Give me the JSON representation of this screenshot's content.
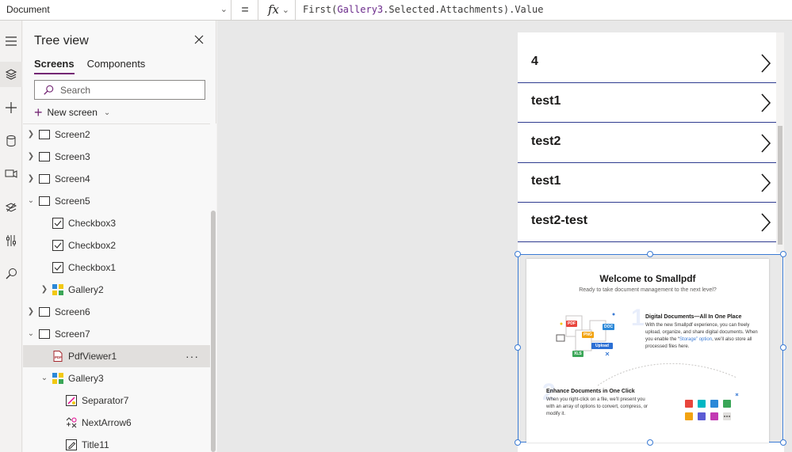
{
  "formula_bar": {
    "property": "Document",
    "equals": "=",
    "fx": "fx",
    "formula_func": "First(",
    "formula_arg": "Gallery3",
    "formula_rest": ".Selected.Attachments).Value"
  },
  "rail": {
    "icons": [
      "menu-icon",
      "layers-icon",
      "plus-icon",
      "database-icon",
      "media-icon",
      "components-icon",
      "tools-icon",
      "search-icon"
    ]
  },
  "tree": {
    "title": "Tree view",
    "tabs": [
      "Screens",
      "Components"
    ],
    "search_placeholder": "Search",
    "new_screen": "New screen",
    "items": [
      {
        "label": "Screen2"
      },
      {
        "label": "Screen3"
      },
      {
        "label": "Screen4"
      },
      {
        "label": "Screen5"
      },
      {
        "label": "Checkbox3"
      },
      {
        "label": "Checkbox2"
      },
      {
        "label": "Checkbox1"
      },
      {
        "label": "Gallery2"
      },
      {
        "label": "Screen6"
      },
      {
        "label": "Screen7"
      },
      {
        "label": "PdfViewer1"
      },
      {
        "label": "Gallery3"
      },
      {
        "label": "Separator7"
      },
      {
        "label": "NextArrow6"
      },
      {
        "label": "Title11"
      }
    ],
    "more": "···"
  },
  "gallery": {
    "rows": [
      "4",
      "test1",
      "test2",
      "test1",
      "test2-test"
    ]
  },
  "pdf": {
    "title": "Welcome to Smallpdf",
    "subtitle": "Ready to take document management to the next level?",
    "section1_title": "Digital Documents—All In One Place",
    "section1_text_a": "With the new Smallpdf experience, you can freely upload, organize, and share digital documents. When you enable the “",
    "section1_highlight": "Storage” option",
    "section1_text_b": ", we’ll also store all processed files here.",
    "section2_title": "Enhance Documents in One Click",
    "section2_text": "When you right-click on a file, we’ll present you with an array of options to convert, compress, or modify it.",
    "badges": [
      "PDF",
      "DOC",
      "PNG",
      "XLS"
    ],
    "upload_label": "Upload"
  },
  "colors": {
    "accent": "#742774",
    "selection": "#3b7bd4",
    "separator": "#2e3b8f"
  }
}
